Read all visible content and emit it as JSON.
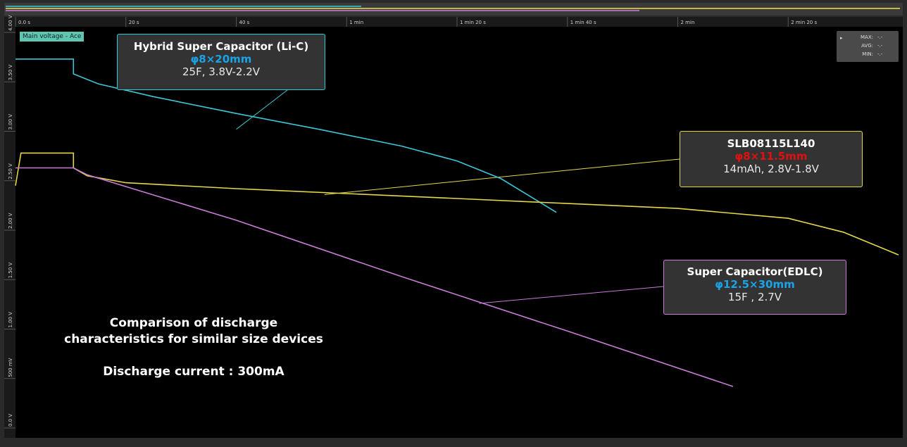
{
  "chart_data": {
    "type": "line",
    "channel_label": "Main voltage - Ace",
    "x_ticks": [
      "0.0 s",
      "20 s",
      "40 s",
      "1 min",
      "1 min 20 s",
      "1 min 40 s",
      "2 min",
      "2 min 20 s"
    ],
    "y_ticks": [
      "4.00 V",
      "3.50 V",
      "3.00 V",
      "2.50 V",
      "2.00 V",
      "1.50 V",
      "1.00 V",
      "500 mV",
      "0.0 V"
    ],
    "xlim": [
      0,
      160
    ],
    "ylim": [
      0,
      4.0
    ],
    "series": [
      {
        "color": "#3ec6d6",
        "points": [
          [
            0,
            3.73
          ],
          [
            10.5,
            3.73
          ],
          [
            10.5,
            3.58
          ],
          [
            15,
            3.48
          ],
          [
            25,
            3.35
          ],
          [
            40,
            3.18
          ],
          [
            55,
            3.02
          ],
          [
            70,
            2.85
          ],
          [
            80,
            2.7
          ],
          [
            88,
            2.52
          ],
          [
            93,
            2.35
          ],
          [
            98,
            2.18
          ]
        ]
      },
      {
        "color": "#e4d84a",
        "points": [
          [
            0,
            2.45
          ],
          [
            1,
            2.78
          ],
          [
            10.5,
            2.78
          ],
          [
            10.5,
            2.63
          ],
          [
            13,
            2.55
          ],
          [
            20,
            2.48
          ],
          [
            40,
            2.42
          ],
          [
            60,
            2.37
          ],
          [
            80,
            2.32
          ],
          [
            100,
            2.27
          ],
          [
            120,
            2.22
          ],
          [
            140,
            2.12
          ],
          [
            150,
            1.98
          ],
          [
            160,
            1.75
          ]
        ]
      },
      {
        "color": "#c77bd6",
        "points": [
          [
            0,
            2.63
          ],
          [
            10.5,
            2.63
          ],
          [
            13,
            2.56
          ],
          [
            40,
            2.1
          ],
          [
            70,
            1.53
          ],
          [
            100,
            0.98
          ],
          [
            130,
            0.42
          ]
        ]
      }
    ],
    "annotations": [
      {
        "title": "Hybrid Super Capacitor (Li-C)",
        "size": "φ8×20mm",
        "spec": "25F, 3.8V-2.2V",
        "size_color": "#1aa3e8",
        "border": "#3ec6d6"
      },
      {
        "title": "SLB08115L140",
        "size": "φ8×11.5mm",
        "spec": "14mAh, 2.8V-1.8V",
        "size_color": "#e01010",
        "border": "#e4d84a"
      },
      {
        "title": "Super Capacitor(EDLC)",
        "size": "φ12.5×30mm",
        "spec": "15F , 2.7V",
        "size_color": "#1aa3e8",
        "border": "#c77bd6"
      }
    ],
    "note_lines": [
      "Comparison of discharge",
      "characteristics for similar size devices",
      "",
      "Discharge current : 300mA"
    ],
    "stats": {
      "max_label": "MAX:",
      "max_val": "-.-",
      "avg_label": "AVG:",
      "avg_val": "-.-",
      "min_label": "MIN:",
      "min_val": "-.-"
    },
    "grid": true
  }
}
